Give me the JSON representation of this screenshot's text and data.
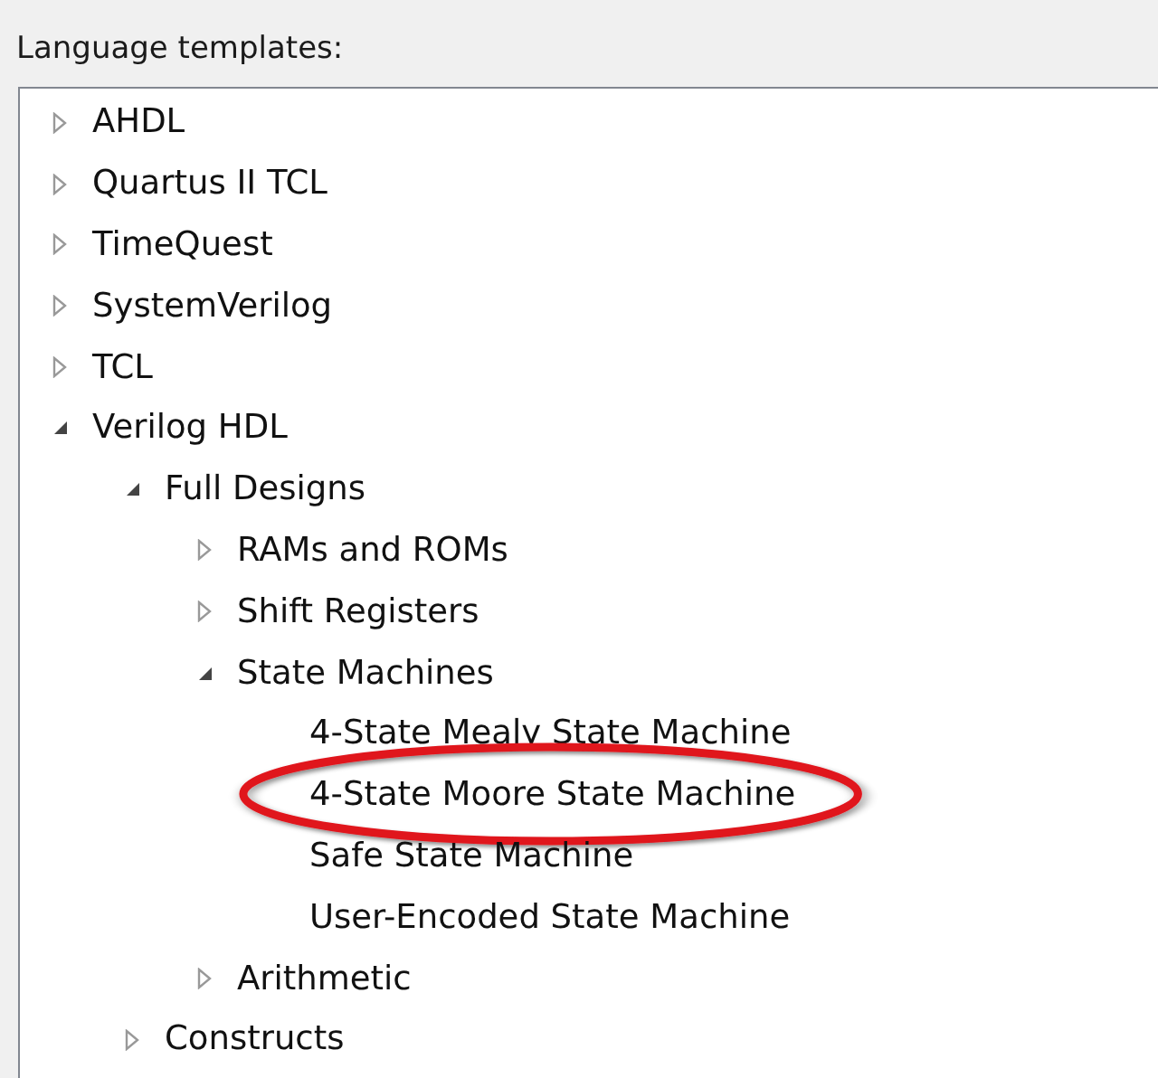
{
  "label": "Language templates:",
  "tree": {
    "items": [
      {
        "kind": "folder",
        "label": "AHDL",
        "expanded": false
      },
      {
        "kind": "folder",
        "label": "Quartus II TCL",
        "expanded": false
      },
      {
        "kind": "folder",
        "label": "TimeQuest",
        "expanded": false
      },
      {
        "kind": "folder",
        "label": "SystemVerilog",
        "expanded": false
      },
      {
        "kind": "folder",
        "label": "TCL",
        "expanded": false
      },
      {
        "kind": "folder",
        "label": "Verilog HDL",
        "expanded": true,
        "children": [
          {
            "kind": "folder",
            "label": "Full Designs",
            "expanded": true,
            "children": [
              {
                "kind": "folder",
                "label": "RAMs and ROMs",
                "expanded": false
              },
              {
                "kind": "folder",
                "label": "Shift Registers",
                "expanded": false
              },
              {
                "kind": "folder",
                "label": "State Machines",
                "expanded": true,
                "children": [
                  {
                    "kind": "template",
                    "label": "4-State Mealy State Machine",
                    "circled": false
                  },
                  {
                    "kind": "template",
                    "label": "4-State Moore State Machine",
                    "circled": true
                  },
                  {
                    "kind": "template",
                    "label": "Safe State Machine",
                    "circled": false
                  },
                  {
                    "kind": "template",
                    "label": "User-Encoded State Machine",
                    "circled": false
                  }
                ]
              },
              {
                "kind": "folder",
                "label": "Arithmetic",
                "expanded": false
              }
            ]
          },
          {
            "kind": "folder",
            "label": "Constructs",
            "expanded": false
          }
        ]
      }
    ]
  }
}
